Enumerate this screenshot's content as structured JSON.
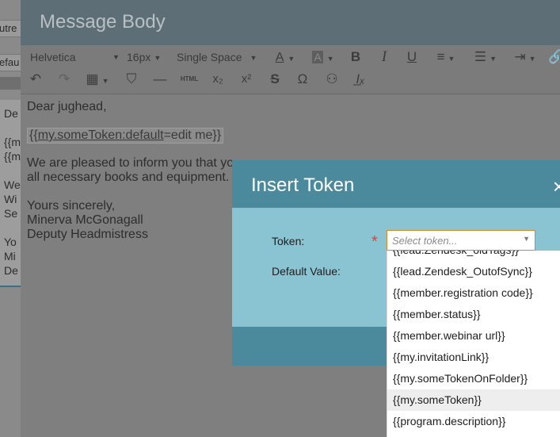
{
  "background_page": {
    "fields": [
      "utre",
      "efau"
    ],
    "lines": [
      "De",
      "{{m",
      "{{m",
      "We",
      "Wi",
      "Se",
      "Yo",
      "Mi",
      "De"
    ]
  },
  "message_body": {
    "title": "Message Body",
    "toolbar": {
      "font_family": "Helvetica",
      "font_size": "16px",
      "line_spacing": "Single Space",
      "html_label": "HTML"
    },
    "editor": {
      "greeting": "Dear jughead,",
      "token_prefix": "{{",
      "token_name": "my.someToken:default",
      "token_suffix": "=edit me}}",
      "para_line1": "We are pleased to inform you that yo",
      "para_line2": "all necessary books and equipment.",
      "closing": "Yours sincerely,",
      "signer": "Minerva McGonagall",
      "signer_title": "Deputy Headmistress"
    }
  },
  "insert_token": {
    "title": "Insert Token",
    "close": "×",
    "token_label": "Token:",
    "required_marker": "*",
    "token_placeholder": "Select token...",
    "default_value_label": "Default Value:",
    "options": [
      "{{lead.Zendesk_oldTags}}",
      "{{lead.Zendesk_OutofSync}}",
      "{{member.registration code}}",
      "{{member.status}}",
      "{{member.webinar url}}",
      "{{my.invitationLink}}",
      "{{my.someTokenOnFolder}}",
      "{{my.someToken}}",
      "{{program.description}}"
    ],
    "highlighted_option": "{{my.someToken}}"
  }
}
